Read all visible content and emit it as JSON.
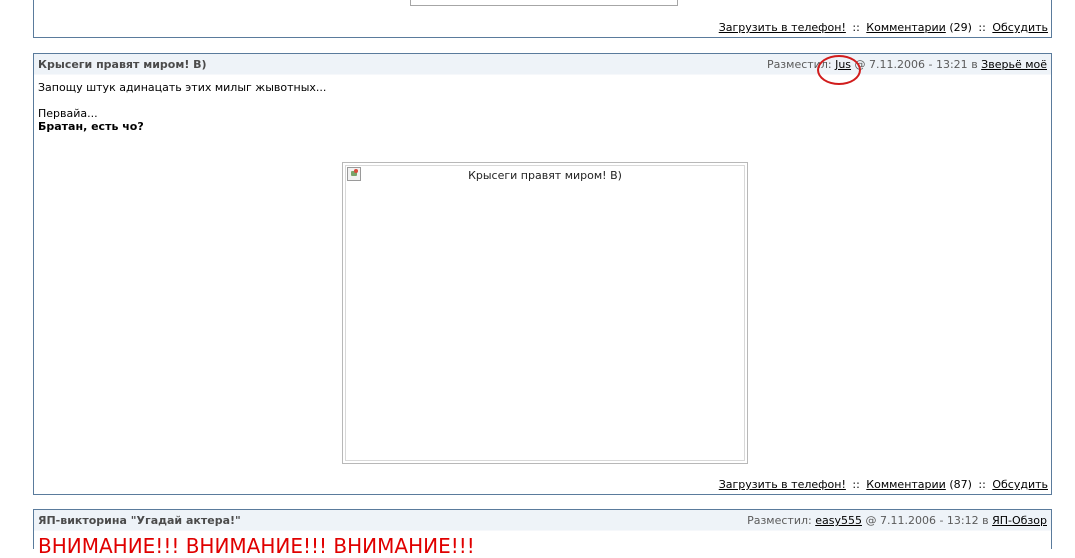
{
  "post_top": {
    "footer": {
      "phone_link": "Загрузить в телефон!",
      "sep1": "::",
      "comments_link": "Комментарии",
      "comments_count": "(29)",
      "sep2": "::",
      "discuss_link": "Обсудить"
    }
  },
  "post_main": {
    "title": "Крысеги правят миром! В)",
    "meta": {
      "posted_by_label": "Разместил:",
      "author": "Jus",
      "at": "@",
      "datetime": "7.11.2006 - 13:21",
      "in_label": "в",
      "category": "Зверьё моё"
    },
    "body": {
      "line1": "Запощу штук адинацать этих милыг жывотных...",
      "line2": "Первайа...",
      "line3_bold": "Братан, есть чо?"
    },
    "image_alt": "Крысеги правят миром! В)",
    "footer": {
      "phone_link": "Загрузить в телефон!",
      "sep1": "::",
      "comments_link": "Комментарии",
      "comments_count": "(87)",
      "sep2": "::",
      "discuss_link": "Обсудить"
    }
  },
  "post_bottom": {
    "title": "ЯП-викторина \"Угадай актера!\"",
    "meta": {
      "posted_by_label": "Разместил:",
      "author": "easy555",
      "at": "@",
      "datetime": "7.11.2006 - 13:12",
      "in_label": "в",
      "category": "ЯП-Обзор"
    },
    "body_red": "ВНИМАНИЕ!!! ВНИМАНИЕ!!! ВНИМАНИЕ!!!"
  },
  "colors": {
    "border": "#5a7b9c",
    "header_bg": "#eef3f8",
    "highlight": "#d11c1c",
    "alert_text": "#e00000"
  }
}
